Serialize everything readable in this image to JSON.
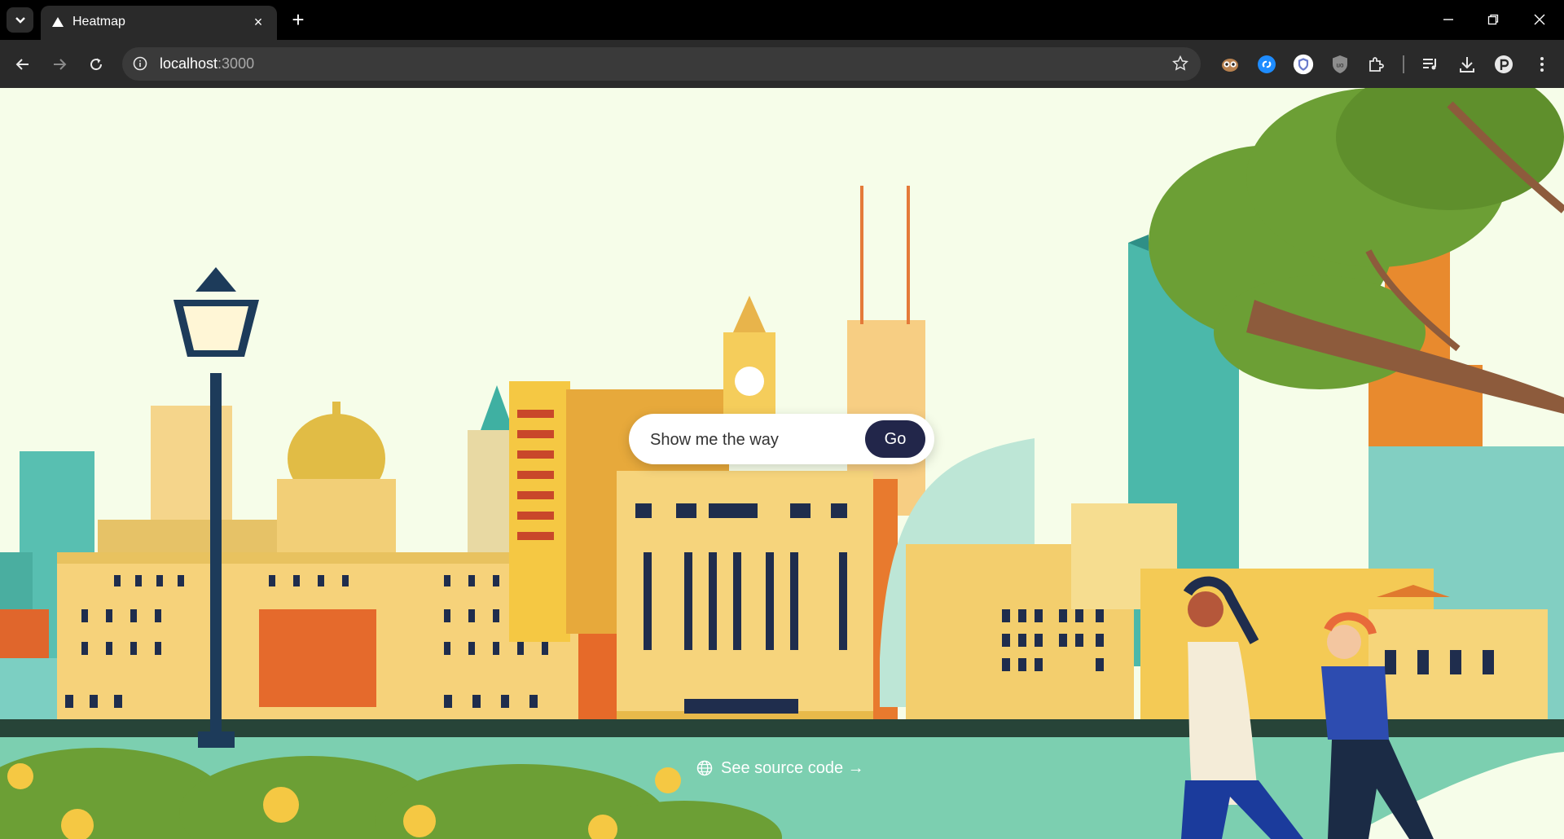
{
  "browser": {
    "tab_title": "Heatmap",
    "new_tab_symbol": "+",
    "close_symbol": "×",
    "url_host": "localhost",
    "url_port": ":3000"
  },
  "icons": {
    "tab_list": "chevron-down-icon",
    "favicon": "triangle-logo-icon",
    "back": "arrow-left-icon",
    "forward": "arrow-right-icon",
    "reload": "reload-icon",
    "site_info": "info-icon",
    "bookmark": "star-icon",
    "extensions": [
      "owl-extension-icon",
      "shazam-extension-icon",
      "privacy-badger-icon",
      "ublock-origin-icon",
      "puzzle-extensions-icon"
    ],
    "media": "media-queue-icon",
    "downloads": "download-icon",
    "profile": "profile-p-icon",
    "menu": "kebab-menu-icon",
    "globe": "globe-icon"
  },
  "colors": {
    "page_bg": "#f6fde9",
    "go_button": "#22264a",
    "water": "#7ccfb0",
    "promenade": "#274438"
  },
  "main": {
    "search_placeholder": "Show me the way",
    "go_label": "Go",
    "source_link": "See source code →"
  }
}
